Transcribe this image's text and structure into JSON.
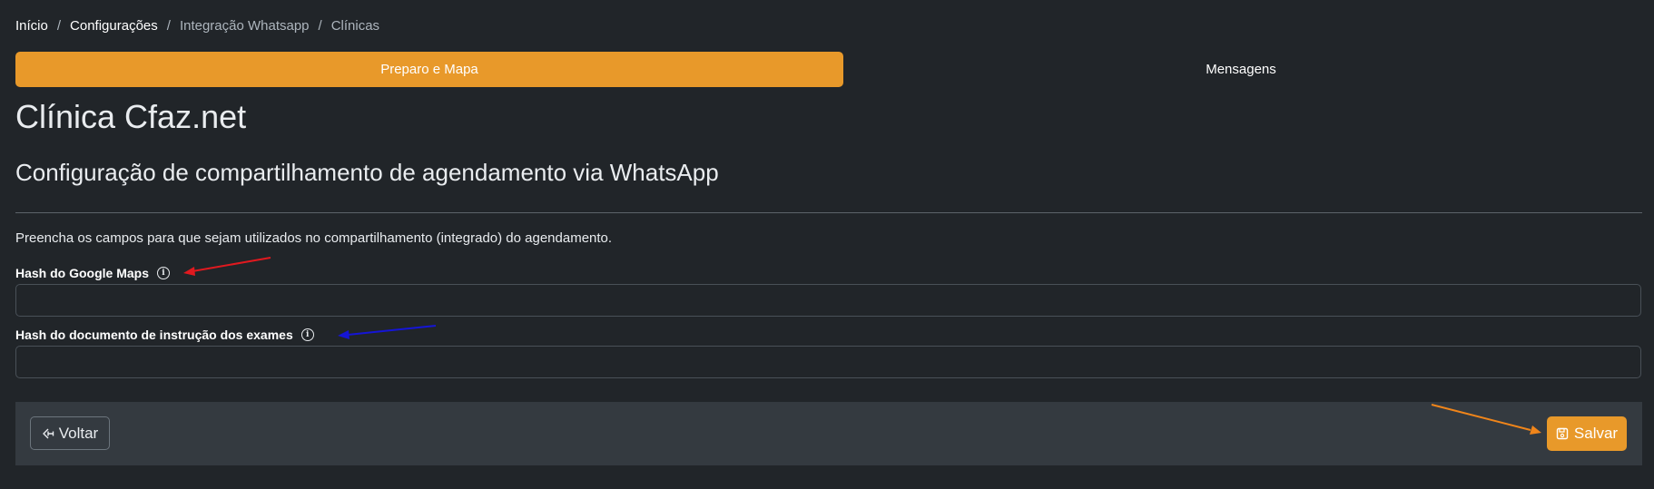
{
  "breadcrumb": {
    "items": [
      "Início",
      "Configurações",
      "Integração Whatsapp",
      "Clínicas"
    ],
    "separator": "/"
  },
  "tabs": [
    {
      "label": "Preparo e Mapa",
      "active": true
    },
    {
      "label": "Mensagens",
      "active": false
    }
  ],
  "page": {
    "title": "Clínica Cfaz.net",
    "section_title": "Configuração de compartilhamento de agendamento via WhatsApp",
    "description": "Preencha os campos para que sejam utilizados no compartilhamento (integrado) do agendamento."
  },
  "fields": {
    "maps_hash": {
      "label": "Hash do Google Maps",
      "value": "",
      "icon": "info-icon"
    },
    "exam_doc_hash": {
      "label": "Hash do documento de instrução dos exames",
      "value": "",
      "icon": "info-icon"
    }
  },
  "footer": {
    "back_label": "Voltar",
    "back_icon": "arrow-left-icon",
    "save_label": "Salvar",
    "save_icon": "floppy-disk-icon"
  },
  "colors": {
    "background": "#212529",
    "accent": "#e8992a",
    "footer_bar": "#343a40",
    "annotation_red": "#e0191f",
    "annotation_blue": "#1515d6",
    "annotation_orange": "#f0851a"
  },
  "annotations": [
    "red-arrow",
    "blue-arrow",
    "orange-arrow"
  ]
}
